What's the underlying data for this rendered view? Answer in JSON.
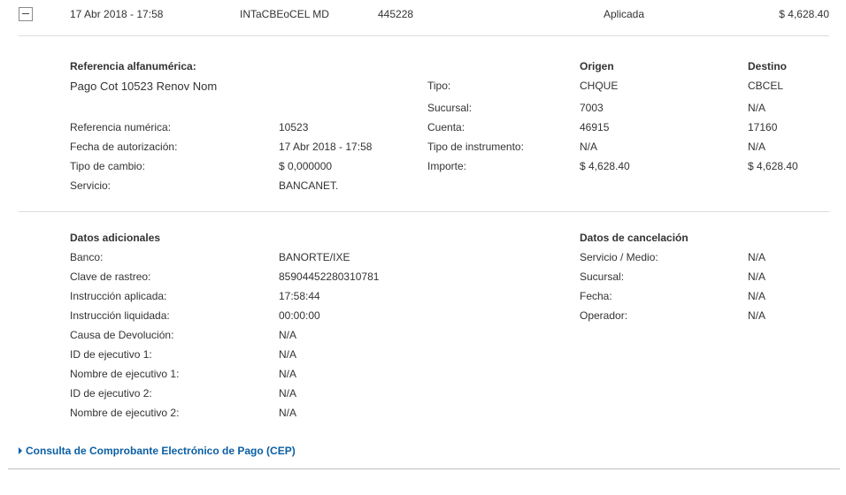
{
  "row": {
    "date": "17 Abr 2018 - 17:58",
    "description": "INTaCBEoCEL MD",
    "reference": "445228",
    "status": "Aplicada",
    "amount": "$ 4,628.40"
  },
  "detail": {
    "alpha_ref_label": "Referencia alfanumérica:",
    "alpha_ref_value": "Pago Cot 10523 Renov Nom",
    "num_ref_label": "Referencia numérica:",
    "num_ref_value": "10523",
    "auth_date_label": "Fecha de autorización:",
    "auth_date_value": "17 Abr 2018 - 17:58",
    "exchange_label": "Tipo de cambio:",
    "exchange_value": "$ 0,000000",
    "service_label": "Servicio:",
    "service_value": "BANCANET.",
    "origin_header": "Origen",
    "dest_header": "Destino",
    "tipo_label": "Tipo:",
    "tipo_origin": "CHQUE",
    "tipo_dest": "CBCEL",
    "sucursal_label": "Sucursal:",
    "sucursal_origin": "7003",
    "sucursal_dest": "N/A",
    "cuenta_label": "Cuenta:",
    "cuenta_origin": "46915",
    "cuenta_dest": "17160",
    "instrumento_label": "Tipo de instrumento:",
    "instrumento_origin": "N/A",
    "instrumento_dest": "N/A",
    "importe_label": "Importe:",
    "importe_origin": "$ 4,628.40",
    "importe_dest": "$ 4,628.40"
  },
  "additional": {
    "title": "Datos adicionales",
    "banco_label": "Banco:",
    "banco_value": "BANORTE/IXE",
    "clave_label": "Clave de rastreo:",
    "clave_value": "85904452280310781",
    "aplicada_label": "Instrucción aplicada:",
    "aplicada_value": "17:58:44",
    "liquidada_label": "Instrucción liquidada:",
    "liquidada_value": "00:00:00",
    "devolucion_label": "Causa de Devolución:",
    "devolucion_value": "N/A",
    "id_ej1_label": "ID de ejecutivo 1:",
    "id_ej1_value": "N/A",
    "nombre_ej1_label": "Nombre de ejecutivo 1:",
    "nombre_ej1_value": "N/A",
    "id_ej2_label": "ID de ejecutivo 2:",
    "id_ej2_value": "N/A",
    "nombre_ej2_label": "Nombre de ejecutivo 2:",
    "nombre_ej2_value": "N/A"
  },
  "cancel": {
    "title": "Datos de cancelación",
    "servicio_label": "Servicio / Medio:",
    "servicio_value": "N/A",
    "sucursal_label": "Sucursal:",
    "sucursal_value": "N/A",
    "fecha_label": "Fecha:",
    "fecha_value": "N/A",
    "operador_label": "Operador:",
    "operador_value": "N/A"
  },
  "cep_link": "Consulta de Comprobante Electrónico de Pago (CEP)",
  "icons": {
    "collapse": "minus-icon",
    "caret": "caret-right-icon"
  },
  "colors": {
    "link": "#0b5fa5",
    "divider": "#dcdcdc",
    "text": "#333333"
  }
}
